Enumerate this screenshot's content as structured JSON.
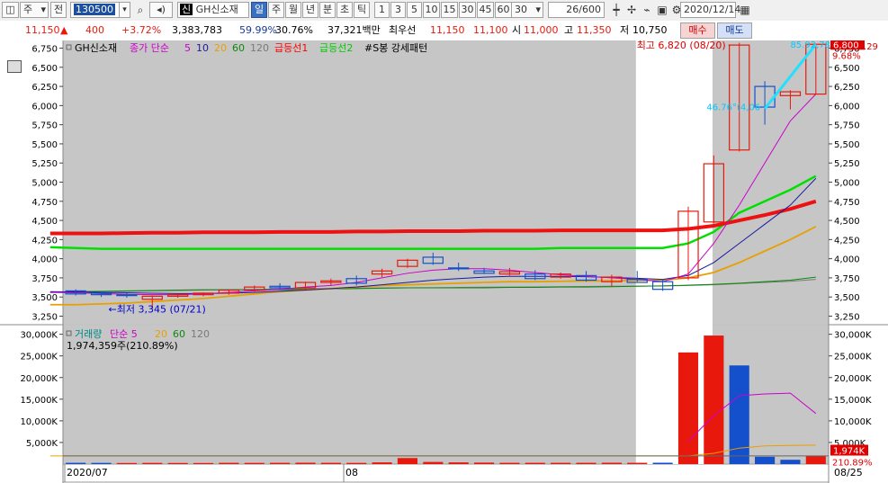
{
  "toolbar": {
    "period_selector": "주",
    "prev_label": "전",
    "stock_code": "130500",
    "stock_badge": "신",
    "stock_name": "GH신소재",
    "period_tabs": [
      "일",
      "주",
      "월",
      "년",
      "분",
      "초",
      "틱"
    ],
    "selected_tab": "일",
    "interval_buttons": [
      "1",
      "3",
      "5",
      "10",
      "15",
      "30",
      "45",
      "60"
    ],
    "interval_value": "30",
    "count_value": "26",
    "count_max": "/600",
    "date_value": "2020/12/14"
  },
  "quote": {
    "price": "11,150",
    "change_symbol": "▲",
    "change": "400",
    "change_pct": "+3.72%",
    "volume": "3,383,783",
    "ratio1": "59.99%",
    "ratio2": "30.76%",
    "amount": "37,321백만",
    "priority_label": "최우선",
    "best_ask": "11,150",
    "best_bid": "11,100",
    "open_label": "시",
    "open": "11,000",
    "high_label": "고",
    "high": "11,350",
    "low_label": "저",
    "low": "10,750",
    "buy_label": "매수",
    "sell_label": "매도"
  },
  "price_panel": {
    "legend": [
      {
        "text": "GH신소재",
        "color": "#000000"
      },
      {
        "text": "종가 단순",
        "color": "#cc00cc"
      },
      {
        "text": "5",
        "color": "#cc00cc"
      },
      {
        "text": "10",
        "color": "#1a1aa0"
      },
      {
        "text": "20",
        "color": "#e8a000"
      },
      {
        "text": "60",
        "color": "#0a8a0a"
      },
      {
        "text": "120",
        "color": "#7a7a7a"
      },
      {
        "text": "급등선1",
        "color": "#ff0000"
      },
      {
        "text": "급등선2",
        "color": "#00cc00"
      },
      {
        "text": "#S봉 강세패턴",
        "color": "#000000"
      }
    ],
    "y_ticks": [
      "6,750",
      "6,500",
      "6,250",
      "6,000",
      "5,750",
      "5,500",
      "5,250",
      "5,000",
      "4,750",
      "4,500",
      "4,250",
      "4,000",
      "3,750",
      "3,500",
      "3,250"
    ],
    "right_top_label": "LC:103.29",
    "right_price_badge": "6,800",
    "right_pct_label": "9.68%",
    "high_annotation": "최고 6,820 (08/20)",
    "low_annotation": "←최저 3,345 (07/21)",
    "angle_annotation": "46.76°(4,06",
    "trend_annotation": "85.92,78"
  },
  "volume_panel": {
    "legend": [
      {
        "text": "거래량",
        "color": "#008888"
      },
      {
        "text": "단순 5",
        "color": "#cc00cc"
      },
      {
        "text": "20",
        "color": "#e8a000"
      },
      {
        "text": "60",
        "color": "#0a8a0a"
      },
      {
        "text": "120",
        "color": "#7a7a7a"
      }
    ],
    "subtitle": "1,974,359주(210.89%)",
    "y_ticks": [
      "30,000K",
      "25,000K",
      "20,000K",
      "15,000K",
      "10,000K",
      "5,000K"
    ],
    "right_badge_value": "1,974K",
    "right_badge_pct": "210.89%"
  },
  "x_axis": {
    "labels": [
      "2020/07",
      "08"
    ],
    "right_label": "08/25"
  },
  "colors": {
    "up": "#e8190c",
    "down": "#1450cc",
    "panel_bg": "#c6c6c6",
    "highlight_bg": "#ffffff"
  },
  "chart_data": [
    {
      "type": "candlestick",
      "title": "GH신소재",
      "ylim": [
        3150,
        6850
      ],
      "candles": [
        {
          "o": 3580,
          "h": 3600,
          "l": 3520,
          "c": 3540
        },
        {
          "o": 3550,
          "h": 3570,
          "l": 3500,
          "c": 3530
        },
        {
          "o": 3530,
          "h": 3550,
          "l": 3490,
          "c": 3520
        },
        {
          "o": 3470,
          "h": 3520,
          "l": 3345,
          "c": 3510
        },
        {
          "o": 3510,
          "h": 3540,
          "l": 3490,
          "c": 3530
        },
        {
          "o": 3530,
          "h": 3560,
          "l": 3510,
          "c": 3550
        },
        {
          "o": 3550,
          "h": 3600,
          "l": 3530,
          "c": 3590
        },
        {
          "o": 3590,
          "h": 3650,
          "l": 3570,
          "c": 3630
        },
        {
          "o": 3640,
          "h": 3680,
          "l": 3600,
          "c": 3620
        },
        {
          "o": 3620,
          "h": 3700,
          "l": 3600,
          "c": 3690
        },
        {
          "o": 3690,
          "h": 3740,
          "l": 3650,
          "c": 3710
        },
        {
          "o": 3740,
          "h": 3780,
          "l": 3650,
          "c": 3680
        },
        {
          "o": 3800,
          "h": 3870,
          "l": 3760,
          "c": 3840
        },
        {
          "o": 3900,
          "h": 4000,
          "l": 3880,
          "c": 3980
        },
        {
          "o": 4020,
          "h": 4080,
          "l": 3920,
          "c": 3940
        },
        {
          "o": 3880,
          "h": 3950,
          "l": 3840,
          "c": 3870
        },
        {
          "o": 3840,
          "h": 3880,
          "l": 3800,
          "c": 3810
        },
        {
          "o": 3800,
          "h": 3880,
          "l": 3780,
          "c": 3830
        },
        {
          "o": 3800,
          "h": 3850,
          "l": 3720,
          "c": 3740
        },
        {
          "o": 3760,
          "h": 3820,
          "l": 3740,
          "c": 3800
        },
        {
          "o": 3780,
          "h": 3840,
          "l": 3700,
          "c": 3720
        },
        {
          "o": 3700,
          "h": 3790,
          "l": 3640,
          "c": 3760
        },
        {
          "o": 3730,
          "h": 3840,
          "l": 3700,
          "c": 3690
        },
        {
          "o": 3700,
          "h": 3730,
          "l": 3580,
          "c": 3600
        },
        {
          "o": 3750,
          "h": 4680,
          "l": 3720,
          "c": 4620
        },
        {
          "o": 4480,
          "h": 5350,
          "l": 4460,
          "c": 5240
        },
        {
          "o": 5420,
          "h": 6820,
          "l": 5400,
          "c": 6790
        },
        {
          "o": 6250,
          "h": 6320,
          "l": 5750,
          "c": 5980
        },
        {
          "o": 6130,
          "h": 6200,
          "l": 5950,
          "c": 6180
        },
        {
          "o": 6150,
          "h": 6800,
          "l": 6150,
          "c": 6800
        }
      ],
      "ma5": [
        3560,
        3555,
        3545,
        3535,
        3530,
        3530,
        3540,
        3560,
        3580,
        3600,
        3630,
        3650,
        3690,
        3750,
        3810,
        3850,
        3870,
        3870,
        3850,
        3820,
        3790,
        3770,
        3750,
        3730,
        3700,
        3800,
        4200,
        4700,
        5250,
        5800,
        6150
      ],
      "ma10": [
        3570,
        3565,
        3560,
        3555,
        3550,
        3545,
        3545,
        3550,
        3560,
        3575,
        3590,
        3610,
        3630,
        3660,
        3690,
        3720,
        3740,
        3760,
        3770,
        3770,
        3770,
        3765,
        3755,
        3745,
        3730,
        3780,
        3950,
        4200,
        4450,
        4700,
        5050
      ],
      "ma20": [
        3400,
        3400,
        3410,
        3420,
        3440,
        3460,
        3480,
        3510,
        3540,
        3570,
        3590,
        3610,
        3630,
        3650,
        3660,
        3670,
        3680,
        3690,
        3700,
        3700,
        3705,
        3710,
        3710,
        3715,
        3720,
        3750,
        3820,
        3950,
        4100,
        4250,
        4420
      ],
      "ma60": [
        3560,
        3570,
        3575,
        3580,
        3585,
        3590,
        3595,
        3595,
        3595,
        3595,
        3600,
        3605,
        3610,
        3615,
        3620,
        3620,
        3620,
        3620,
        3625,
        3625,
        3630,
        3630,
        3635,
        3640,
        3645,
        3655,
        3665,
        3680,
        3700,
        3720,
        3760
      ],
      "ma120": [
        3560,
        3565,
        3570,
        3575,
        3580,
        3585,
        3590,
        3595,
        3600,
        3605,
        3610,
        3612,
        3615,
        3618,
        3620,
        3622,
        3625,
        3628,
        3630,
        3632,
        3635,
        3637,
        3640,
        3642,
        3645,
        3650,
        3660,
        3675,
        3690,
        3705,
        3730
      ],
      "surge1": [
        4330,
        4330,
        4330,
        4335,
        4340,
        4340,
        4345,
        4345,
        4345,
        4350,
        4350,
        4350,
        4355,
        4355,
        4360,
        4360,
        4360,
        4365,
        4365,
        4365,
        4370,
        4370,
        4370,
        4370,
        4370,
        4390,
        4430,
        4500,
        4570,
        4650,
        4750
      ],
      "surge2": [
        4150,
        4140,
        4130,
        4130,
        4130,
        4130,
        4130,
        4130,
        4130,
        4130,
        4130,
        4130,
        4130,
        4130,
        4130,
        4130,
        4130,
        4130,
        4130,
        4130,
        4140,
        4140,
        4140,
        4140,
        4140,
        4200,
        4350,
        4600,
        4750,
        4900,
        5080
      ]
    },
    {
      "type": "bar",
      "title": "거래량",
      "unit": "K",
      "ylim": [
        0,
        32000
      ],
      "values": [
        300,
        280,
        250,
        280,
        260,
        250,
        300,
        280,
        300,
        320,
        300,
        280,
        400,
        1400,
        500,
        400,
        350,
        300,
        300,
        300,
        300,
        320,
        300,
        320,
        25800,
        29700,
        22800,
        1700,
        1000,
        1974
      ],
      "directions": [
        "down",
        "down",
        "up",
        "up",
        "up",
        "up",
        "up",
        "up",
        "up",
        "up",
        "up",
        "up",
        "up",
        "up",
        "up",
        "up",
        "up",
        "up",
        "up",
        "up",
        "up",
        "up",
        "up",
        "down",
        "up",
        "up",
        "down",
        "down",
        "down",
        "up"
      ],
      "ma5": [
        null,
        null,
        null,
        null,
        null,
        null,
        null,
        null,
        null,
        null,
        null,
        null,
        null,
        null,
        null,
        null,
        null,
        null,
        null,
        null,
        null,
        null,
        null,
        null,
        null,
        5300,
        11200,
        15800,
        16200,
        16400,
        11700
      ],
      "ma20": [
        1900,
        1900,
        1900,
        1900,
        1900,
        1900,
        1900,
        1900,
        1900,
        1900,
        1900,
        1900,
        1900,
        1900,
        1900,
        1900,
        1900,
        1900,
        1900,
        1900,
        1900,
        1900,
        1900,
        1900,
        1900,
        1900,
        2500,
        3700,
        4200,
        4300,
        4400
      ]
    }
  ]
}
